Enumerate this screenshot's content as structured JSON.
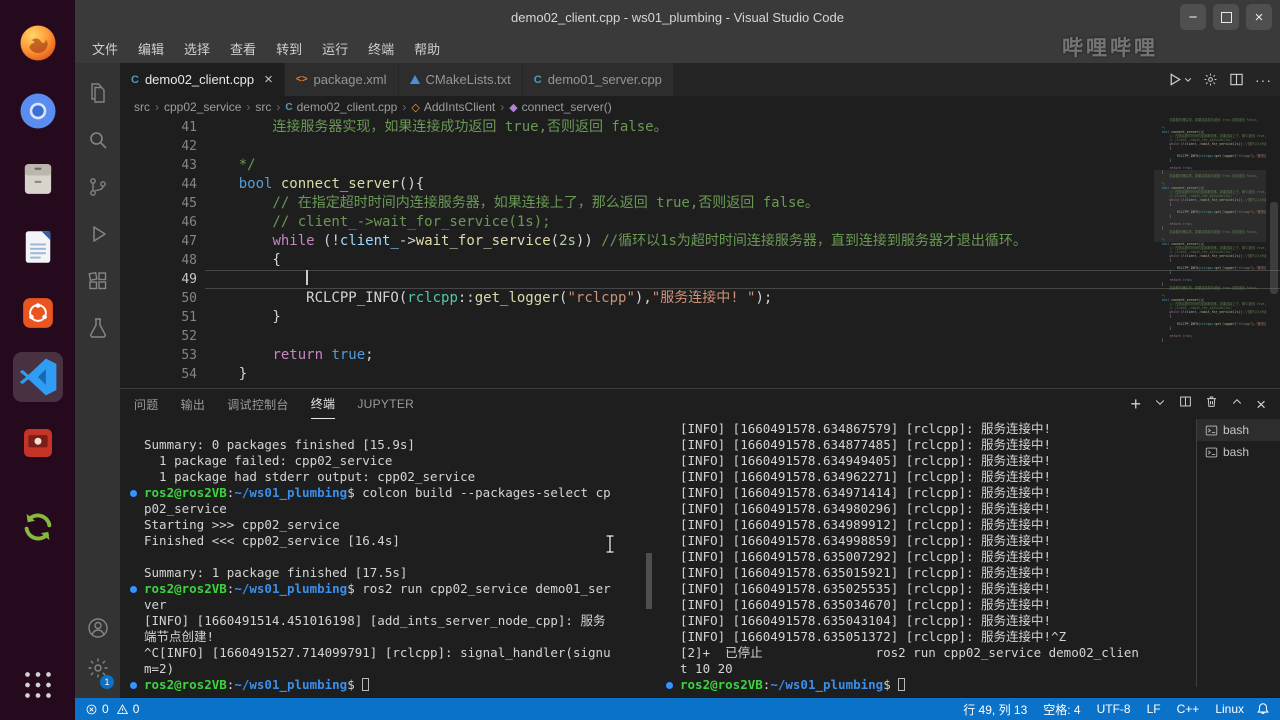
{
  "window": {
    "title": "demo02_client.cpp - ws01_plumbing - Visual Studio Code"
  },
  "watermark": "哔哩哔哩",
  "menubar": {
    "items": [
      "文件",
      "编辑",
      "选择",
      "查看",
      "转到",
      "运行",
      "终端",
      "帮助"
    ]
  },
  "dock": {
    "items": [
      {
        "name": "firefox"
      },
      {
        "name": "chromium"
      },
      {
        "name": "files"
      },
      {
        "name": "libreoffice-writer"
      },
      {
        "name": "ubuntu-software"
      },
      {
        "name": "vscode",
        "active": true
      },
      {
        "name": "screen-recorder"
      },
      {
        "name": "software-updater"
      },
      {
        "name": "show-applications"
      }
    ]
  },
  "activity_bar": {
    "top": [
      {
        "name": "explorer"
      },
      {
        "name": "search"
      },
      {
        "name": "source-control"
      },
      {
        "name": "run-and-debug"
      },
      {
        "name": "extensions"
      },
      {
        "name": "testing"
      }
    ],
    "bottom": [
      {
        "name": "accounts"
      },
      {
        "name": "manage"
      }
    ],
    "badge": "1"
  },
  "editor_tabs": [
    {
      "label": "demo02_client.cpp",
      "icon": "cpp",
      "active": true
    },
    {
      "label": "package.xml",
      "icon": "xml"
    },
    {
      "label": "CMakeLists.txt",
      "icon": "cmake"
    },
    {
      "label": "demo01_server.cpp",
      "icon": "cpp"
    }
  ],
  "editor_actions": [
    {
      "name": "run-or-debug"
    },
    {
      "name": "settings-gear"
    },
    {
      "name": "split-editor"
    },
    {
      "name": "more-actions"
    }
  ],
  "breadcrumb": [
    {
      "label": "src"
    },
    {
      "label": "cpp02_service"
    },
    {
      "label": "src"
    },
    {
      "label": "demo02_client.cpp",
      "icon": "cpp"
    },
    {
      "label": "AddIntsClient",
      "icon": "class"
    },
    {
      "label": "connect_server()",
      "icon": "method"
    }
  ],
  "editor": {
    "cursor_line": 49,
    "cursor_col": 13,
    "lines": [
      {
        "num": "41",
        "segs": [
          {
            "t": "        连接服务器实现，如果连接成功返回 true,否则返回 false。",
            "c": "comment"
          }
        ]
      },
      {
        "num": "42",
        "segs": []
      },
      {
        "num": "43",
        "segs": [
          {
            "t": "    */",
            "c": "comment"
          }
        ]
      },
      {
        "num": "44",
        "segs": [
          {
            "t": "    "
          },
          {
            "t": "bool",
            "c": "kw"
          },
          {
            "t": " "
          },
          {
            "t": "connect_server",
            "c": "fn"
          },
          {
            "t": "(){"
          }
        ]
      },
      {
        "num": "45",
        "segs": [
          {
            "t": "        // 在指定超时时间内连接服务器，如果连接上了，那么返回 true,否则返回 false。",
            "c": "comment"
          }
        ]
      },
      {
        "num": "46",
        "segs": [
          {
            "t": "        // client_->wait_for_service(1s);",
            "c": "comment"
          }
        ]
      },
      {
        "num": "47",
        "segs": [
          {
            "t": "        "
          },
          {
            "t": "while",
            "c": "ctrl"
          },
          {
            "t": " (!"
          },
          {
            "t": "client_",
            "c": "var"
          },
          {
            "t": "->"
          },
          {
            "t": "wait_for_service",
            "c": "fn"
          },
          {
            "t": "("
          },
          {
            "t": "2s",
            "c": "num"
          },
          {
            "t": ")) "
          },
          {
            "t": "//循环以1s为超时时间连接服务器，直到连接到服务器才退出循环。",
            "c": "comment"
          }
        ]
      },
      {
        "num": "48",
        "segs": [
          {
            "t": "        {"
          }
        ]
      },
      {
        "num": "49",
        "current": true,
        "segs": [
          {
            "t": "            "
          }
        ]
      },
      {
        "num": "50",
        "segs": [
          {
            "t": "            RCLCPP_INFO("
          },
          {
            "t": "rclcpp",
            "c": "type"
          },
          {
            "t": "::"
          },
          {
            "t": "get_logger",
            "c": "fn"
          },
          {
            "t": "("
          },
          {
            "t": "\"rclcpp\"",
            "c": "str"
          },
          {
            "t": "),"
          },
          {
            "t": "\"服务连接中! \"",
            "c": "str"
          },
          {
            "t": ");"
          }
        ]
      },
      {
        "num": "51",
        "segs": [
          {
            "t": "        }"
          }
        ]
      },
      {
        "num": "52",
        "segs": []
      },
      {
        "num": "53",
        "segs": [
          {
            "t": "        "
          },
          {
            "t": "return",
            "c": "ctrl"
          },
          {
            "t": " "
          },
          {
            "t": "true",
            "c": "kw"
          },
          {
            "t": ";"
          }
        ]
      },
      {
        "num": "54",
        "segs": [
          {
            "t": "    }"
          }
        ]
      }
    ]
  },
  "panel": {
    "tabs": [
      {
        "label": "问题"
      },
      {
        "label": "输出"
      },
      {
        "label": "调试控制台"
      },
      {
        "label": "终端",
        "active": true
      },
      {
        "label": "JUPYTER"
      }
    ],
    "actions": [
      {
        "name": "new-terminal"
      },
      {
        "name": "terminal-picker-dropdown"
      },
      {
        "name": "split-terminal"
      },
      {
        "name": "kill-terminal"
      },
      {
        "name": "maximize-panel"
      },
      {
        "name": "close-panel"
      }
    ],
    "sidebar": [
      {
        "label": "bash"
      },
      {
        "label": "bash"
      }
    ],
    "terminal_left": {
      "lines": [
        {
          "segs": [
            {
              "t": "Summary: 0 packages finished [15.9s]"
            }
          ]
        },
        {
          "segs": [
            {
              "t": "  1 package failed: cpp02_service"
            }
          ]
        },
        {
          "segs": [
            {
              "t": "  1 package had stderr output: cpp02_service"
            }
          ]
        },
        {
          "deco": true,
          "segs": [
            {
              "t": "ros2@ros2VB",
              "c": "user"
            },
            {
              "t": ":"
            },
            {
              "t": "~/ws01_plumbing",
              "c": "path"
            },
            {
              "t": "$ colcon build --packages-select cp"
            }
          ]
        },
        {
          "segs": [
            {
              "t": "p02_service"
            }
          ]
        },
        {
          "segs": [
            {
              "t": "Starting >>> cpp02_service"
            }
          ]
        },
        {
          "segs": [
            {
              "t": "Finished <<< cpp02_service [16.4s]"
            }
          ]
        },
        {
          "segs": []
        },
        {
          "segs": [
            {
              "t": "Summary: 1 package finished [17.5s]"
            }
          ]
        },
        {
          "deco": true,
          "segs": [
            {
              "t": "ros2@ros2VB",
              "c": "user"
            },
            {
              "t": ":"
            },
            {
              "t": "~/ws01_plumbing",
              "c": "path"
            },
            {
              "t": "$ ros2 run cpp02_service demo01_ser"
            }
          ]
        },
        {
          "segs": [
            {
              "t": "ver"
            }
          ]
        },
        {
          "segs": [
            {
              "t": "[INFO] [1660491514.451016198] [add_ints_server_node_cpp]: 服务"
            }
          ]
        },
        {
          "segs": [
            {
              "t": "端节点创建!"
            }
          ]
        },
        {
          "segs": [
            {
              "t": "^C[INFO] [1660491527.714099791] [rclcpp]: signal_handler(signu"
            }
          ]
        },
        {
          "segs": [
            {
              "t": "m=2)"
            }
          ]
        },
        {
          "deco": true,
          "cursor": true,
          "segs": [
            {
              "t": "ros2@ros2VB",
              "c": "user"
            },
            {
              "t": ":"
            },
            {
              "t": "~/ws01_plumbing",
              "c": "path"
            },
            {
              "t": "$ "
            }
          ]
        }
      ]
    },
    "terminal_right": {
      "lines": [
        {
          "segs": [
            {
              "t": "[INFO] [1660491578.634867579] [rclcpp]: 服务连接中!"
            }
          ]
        },
        {
          "segs": [
            {
              "t": "[INFO] [1660491578.634877485] [rclcpp]: 服务连接中!"
            }
          ]
        },
        {
          "segs": [
            {
              "t": "[INFO] [1660491578.634949405] [rclcpp]: 服务连接中!"
            }
          ]
        },
        {
          "segs": [
            {
              "t": "[INFO] [1660491578.634962271] [rclcpp]: 服务连接中!"
            }
          ]
        },
        {
          "segs": [
            {
              "t": "[INFO] [1660491578.634971414] [rclcpp]: 服务连接中!"
            }
          ]
        },
        {
          "segs": [
            {
              "t": "[INFO] [1660491578.634980296] [rclcpp]: 服务连接中!"
            }
          ]
        },
        {
          "segs": [
            {
              "t": "[INFO] [1660491578.634989912] [rclcpp]: 服务连接中!"
            }
          ]
        },
        {
          "segs": [
            {
              "t": "[INFO] [1660491578.634998859] [rclcpp]: 服务连接中!"
            }
          ]
        },
        {
          "segs": [
            {
              "t": "[INFO] [1660491578.635007292] [rclcpp]: 服务连接中!"
            }
          ]
        },
        {
          "segs": [
            {
              "t": "[INFO] [1660491578.635015921] [rclcpp]: 服务连接中!"
            }
          ]
        },
        {
          "segs": [
            {
              "t": "[INFO] [1660491578.635025535] [rclcpp]: 服务连接中!"
            }
          ]
        },
        {
          "segs": [
            {
              "t": "[INFO] [1660491578.635034670] [rclcpp]: 服务连接中!"
            }
          ]
        },
        {
          "segs": [
            {
              "t": "[INFO] [1660491578.635043104] [rclcpp]: 服务连接中!"
            }
          ]
        },
        {
          "segs": [
            {
              "t": "[INFO] [1660491578.635051372] [rclcpp]: 服务连接中!"
            },
            {
              "t": "^Z"
            }
          ]
        },
        {
          "segs": [
            {
              "t": "[2]+  已停止               ros2 run cpp02_service demo02_clien"
            }
          ]
        },
        {
          "segs": [
            {
              "t": "t 10 20"
            }
          ]
        },
        {
          "deco": true,
          "cursor": true,
          "segs": [
            {
              "t": "ros2@ros2VB",
              "c": "user"
            },
            {
              "t": ":"
            },
            {
              "t": "~/ws01_plumbing",
              "c": "path"
            },
            {
              "t": "$ "
            }
          ]
        }
      ]
    }
  },
  "status_bar": {
    "errors": "0",
    "warnings": "0",
    "right": [
      "行 49, 列 13",
      "空格: 4",
      "UTF-8",
      "LF",
      "C++",
      "Linux"
    ]
  }
}
